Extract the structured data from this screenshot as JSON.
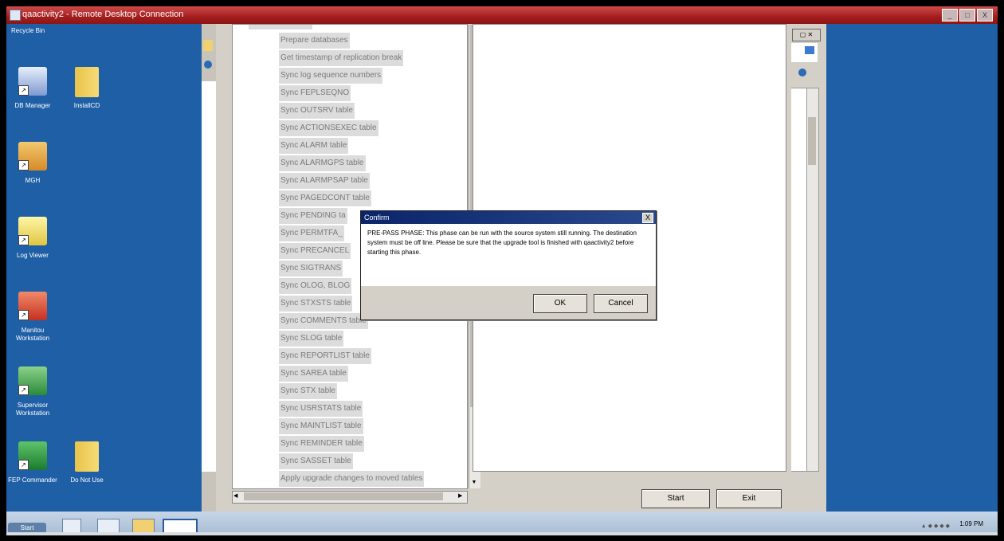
{
  "window": {
    "title": "qaactivity2 - Remote Desktop Connection",
    "controls": [
      "_",
      "□",
      "X"
    ]
  },
  "desktop": {
    "icons": [
      {
        "label": "Recycle Bin"
      },
      {
        "label": "DB Manager"
      },
      {
        "label": "InstallCD"
      },
      {
        "label": "MGH"
      },
      {
        "label": "Log Viewer"
      },
      {
        "label": "Manitou Workstation"
      },
      {
        "label": "Supervisor Workstation"
      },
      {
        "label": "FEP Commander"
      },
      {
        "label": "Do Not Use"
      }
    ]
  },
  "tree": {
    "items": [
      "Prepare databases",
      "Get timestamp of replication break",
      "Sync log sequence numbers",
      "Sync FEPLSEQNO",
      "Sync OUTSRV table",
      "Sync ACTIONSEXEC table",
      "Sync ALARM table",
      "Sync ALARMGPS table",
      "Sync ALARMPSAP table",
      "Sync PAGEDCONT table",
      "Sync PENDING ta",
      "Sync PERMTFA_",
      "Sync PRECANCEL",
      "Sync SIGTRANS",
      "Sync OLOG, BLOG",
      "Sync STXSTS table",
      "Sync COMMENTS table",
      "Sync SLOG table",
      "Sync REPORTLIST table",
      "Sync SAREA table",
      "Sync STX table",
      "Sync USRSTATS table",
      "Sync MAINTLIST table",
      "Sync REMINDER table",
      "Sync SASSET table",
      "Apply upgrade changes to moved tables"
    ]
  },
  "buttons": {
    "start": "Start",
    "exit": "Exit"
  },
  "confirm": {
    "title": "Confirm",
    "close": "X",
    "message": "PRE-PASS PHASE: This phase can be run with the source system still running.  The destination system must be off line.  Please be sure that the upgrade tool is finished with qaactivity2 before starting this phase.",
    "ok": "OK",
    "cancel": "Cancel"
  },
  "taskbar": {
    "start": "Start",
    "clock": "1:09 PM"
  },
  "colors": {
    "desktop": "#1f5fa6",
    "titlebar": "#a21e1e",
    "dialog_title": "#0a246a"
  }
}
